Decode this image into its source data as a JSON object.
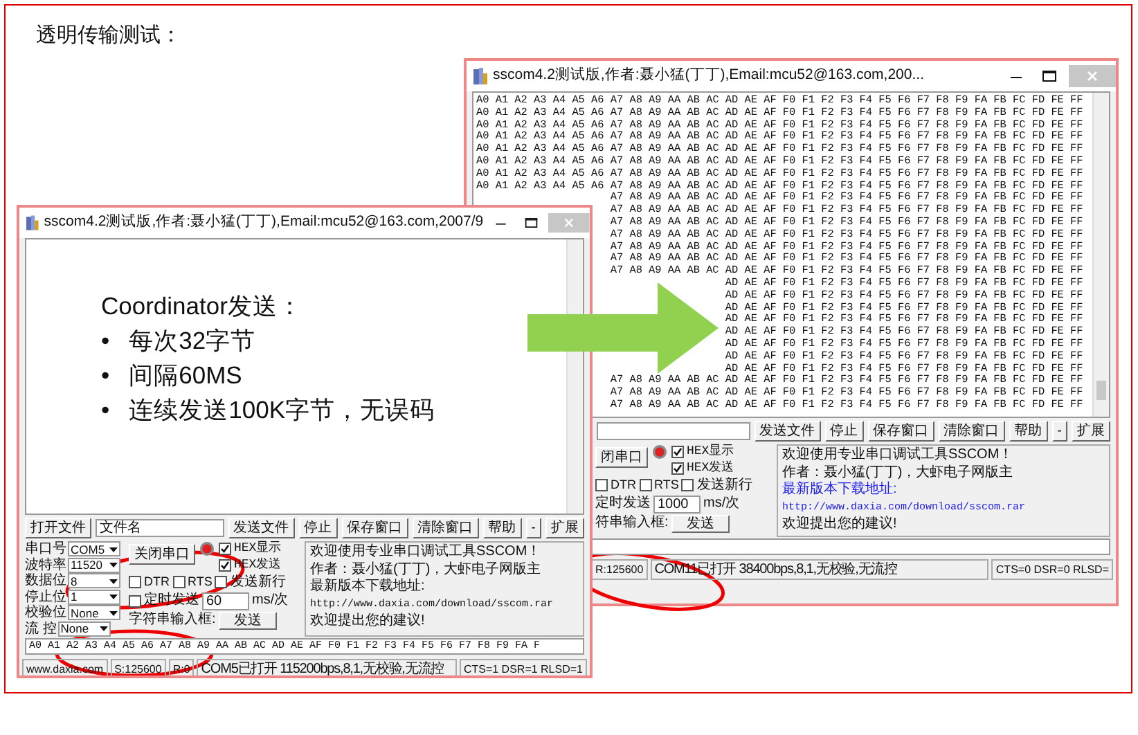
{
  "slide": {
    "title": "透明传输测试："
  },
  "receiver_window": {
    "title": "sscom4.2测试版,作者:聂小猛(丁丁),Email:mcu52@163.com,200...",
    "receive": {
      "kind": "hex",
      "rows": [
        "A0 A1 A2 A3 A4 A5 A6 A7 A8 A9 AA AB AC AD AE AF F0 F1 F2 F3 F4 F5 F6 F7 F8 F9 FA FB FC FD FE FF",
        "A0 A1 A2 A3 A4 A5 A6 A7 A8 A9 AA AB AC AD AE AF F0 F1 F2 F3 F4 F5 F6 F7 F8 F9 FA FB FC FD FE FF",
        "A0 A1 A2 A3 A4 A5 A6 A7 A8 A9 AA AB AC AD AE AF F0 F1 F2 F3 F4 F5 F6 F7 F8 F9 FA FB FC FD FE FF",
        "A0 A1 A2 A3 A4 A5 A6 A7 A8 A9 AA AB AC AD AE AF F0 F1 F2 F3 F4 F5 F6 F7 F8 F9 FA FB FC FD FE FF",
        "A0 A1 A2 A3 A4 A5 A6 A7 A8 A9 AA AB AC AD AE AF F0 F1 F2 F3 F4 F5 F6 F7 F8 F9 FA FB FC FD FE FF",
        "A0 A1 A2 A3 A4 A5 A6 A7 A8 A9 AA AB AC AD AE AF F0 F1 F2 F3 F4 F5 F6 F7 F8 F9 FA FB FC FD FE FF",
        "A0 A1 A2 A3 A4 A5 A6 A7 A8 A9 AA AB AC AD AE AF F0 F1 F2 F3 F4 F5 F6 F7 F8 F9 FA FB FC FD FE FF",
        "A0 A1 A2 A3 A4 A5 A6 A7 A8 A9 AA AB AC AD AE AF F0 F1 F2 F3 F4 F5 F6 F7 F8 F9 FA FB FC FD FE FF",
        "A7 A8 A9 AA AB AC AD AE AF F0 F1 F2 F3 F4 F5 F6 F7 F8 F9 FA FB FC FD FE FF",
        "A7 A8 A9 AA AB AC AD AE AF F0 F1 F2 F3 F4 F5 F6 F7 F8 F9 FA FB FC FD FE FF",
        "A7 A8 A9 AA AB AC AD AE AF F0 F1 F2 F3 F4 F5 F6 F7 F8 F9 FA FB FC FD FE FF",
        "A7 A8 A9 AA AB AC AD AE AF F0 F1 F2 F3 F4 F5 F6 F7 F8 F9 FA FB FC FD FE FF",
        "A7 A8 A9 AA AB AC AD AE AF F0 F1 F2 F3 F4 F5 F6 F7 F8 F9 FA FB FC FD FE FF",
        "A7 A8 A9 AA AB AC AD AE AF F0 F1 F2 F3 F4 F5 F6 F7 F8 F9 FA FB FC FD FE FF",
        "A7 A8 A9 AA AB AC AD AE AF F0 F1 F2 F3 F4 F5 F6 F7 F8 F9 FA FB FC FD FE FF",
        "AD AE AF F0 F1 F2 F3 F4 F5 F6 F7 F8 F9 FA FB FC FD FE FF",
        "AD AE AF F0 F1 F2 F3 F4 F5 F6 F7 F8 F9 FA FB FC FD FE FF",
        "AD AE AF F0 F1 F2 F3 F4 F5 F6 F7 F8 F9 FA FB FC FD FE FF",
        "AD AE AF F0 F1 F2 F3 F4 F5 F6 F7 F8 F9 FA FB FC FD FE FF",
        "AD AE AF F0 F1 F2 F3 F4 F5 F6 F7 F8 F9 FA FB FC FD FE FF",
        "AD AE AF F0 F1 F2 F3 F4 F5 F6 F7 F8 F9 FA FB FC FD FE FF",
        "AD AE AF F0 F1 F2 F3 F4 F5 F6 F7 F8 F9 FA FB FC FD FE FF",
        "AD AE AF F0 F1 F2 F3 F4 F5 F6 F7 F8 F9 FA FB FC FD FE FF",
        "A7 A8 A9 AA AB AC AD AE AF F0 F1 F2 F3 F4 F5 F6 F7 F8 F9 FA FB FC FD FE FF",
        "A7 A8 A9 AA AB AC AD AE AF F0 F1 F2 F3 F4 F5 F6 F7 F8 F9 FA FB FC FD FE FF",
        "A7 A8 A9 AA AB AC AD AE AF F0 F1 F2 F3 F4 F5 F6 F7 F8 F9 FA FB FC FD FE FF"
      ]
    },
    "toolbar_buttons": [
      "发送文件",
      "停止",
      "保存窗口",
      "清除窗口",
      "帮助",
      "-",
      "扩展"
    ],
    "port_button": "闭串口",
    "hex_options": [
      {
        "label": "HEX显示",
        "checked": true
      },
      {
        "label": "HEX发送",
        "checked": true
      }
    ],
    "line_options": [
      {
        "label": "DTR",
        "checked": false
      },
      {
        "label": "RTS",
        "checked": false
      },
      {
        "label": "发送新行",
        "checked": false
      }
    ],
    "timed_send": {
      "label": "定时发送",
      "value": "1000",
      "unit": "ms/次"
    },
    "input_label": "符串输入框:",
    "send_button": "发送",
    "info_lines": [
      {
        "kind": "text",
        "text": "欢迎使用专业串口调试工具SSCOM！"
      },
      {
        "kind": "text",
        "text": "作者：聂小猛(丁丁)，大虾电子网版主"
      },
      {
        "kind": "link",
        "text": "最新版本下载地址:"
      },
      {
        "kind": "link",
        "text": "http://www.daxia.com/download/sscom.rar"
      },
      {
        "kind": "text",
        "text": "欢迎提出您的建议!"
      }
    ],
    "status": [
      "R:125600",
      "COM11已打开  38400bps,8,1,无校验,无流控",
      "CTS=0 DSR=0 RLSD="
    ]
  },
  "sender_window": {
    "title": "sscom4.2测试版,作者:聂小猛(丁丁),Email:mcu52@163.com,2007/9",
    "receive": {
      "kind": "slide",
      "heading": "Coordinator发送：",
      "bullets": [
        {
          "mark": "•",
          "text": "每次32字节"
        },
        {
          "mark": "•",
          "text": "间隔60MS"
        },
        {
          "mark": "•",
          "text": "连续发送100K字节，无误码"
        }
      ]
    },
    "file_button": "打开文件",
    "file_field": "文件名",
    "toolbar_buttons": [
      "发送文件",
      "停止",
      "保存窗口",
      "清除窗口",
      "帮助",
      "-",
      "扩展"
    ],
    "port_settings": [
      {
        "label": "串口号",
        "value": "COM5"
      },
      {
        "label": "波特率",
        "value": "11520"
      },
      {
        "label": "数据位",
        "value": "8"
      },
      {
        "label": "停止位",
        "value": "1"
      },
      {
        "label": "校验位",
        "value": "None"
      },
      {
        "label": "流 控",
        "value": "None"
      }
    ],
    "port_button": "关闭串口",
    "hex_options": [
      {
        "label": "HEX显示",
        "checked": true
      },
      {
        "label": "HEX发送",
        "checked": true
      }
    ],
    "line_options": [
      {
        "label": "DTR",
        "checked": false
      },
      {
        "label": "RTS",
        "checked": false
      },
      {
        "label": "发送新行",
        "checked": false
      }
    ],
    "timed_send": {
      "label": "定时发送",
      "checked": false,
      "value": "60",
      "unit": "ms/次"
    },
    "input_label": "字符串输入框:",
    "send_button": "发送",
    "info_lines": [
      {
        "kind": "text",
        "text": "欢迎使用专业串口调试工具SSCOM！"
      },
      {
        "kind": "text",
        "text": "作者：聂小猛(丁丁)，大虾电子网版主"
      },
      {
        "kind": "text",
        "text": "最新版本下载地址:"
      },
      {
        "kind": "text",
        "text": "http://www.daxia.com/download/sscom.rar"
      },
      {
        "kind": "text",
        "text": "欢迎提出您的建议!"
      }
    ],
    "send_data": "A0 A1 A2 A3 A4 A5 A6 A7 A8 A9 AA AB AC AD AE AF F0 F1 F2 F3 F4 F5 F6 F7 F8 F9 FA F",
    "status": [
      "www.daxia.com",
      "S:125600",
      "R:0",
      "COM5已打开  115200bps,8,1,无校验,无流控",
      "CTS=1 DSR=1 RLSD=1"
    ]
  }
}
